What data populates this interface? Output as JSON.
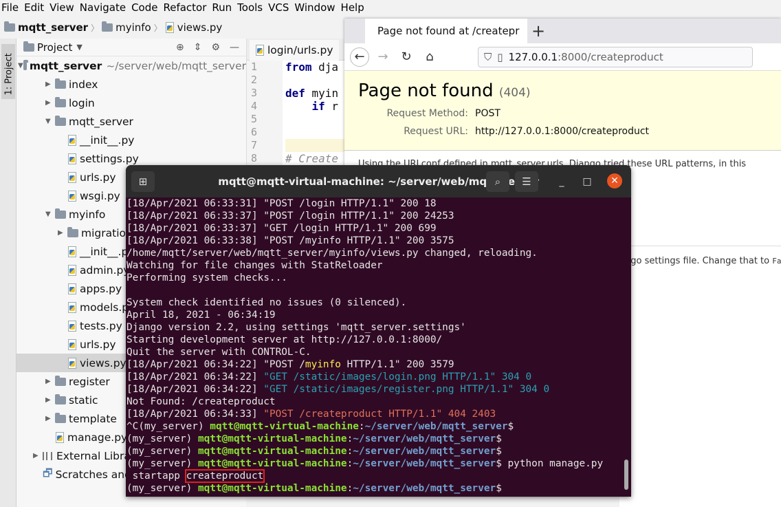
{
  "menubar": [
    "File",
    "Edit",
    "View",
    "Navigate",
    "Code",
    "Refactor",
    "Run",
    "Tools",
    "VCS",
    "Window",
    "Help"
  ],
  "breadcrumb": [
    "mqtt_server",
    "myinfo",
    "views.py"
  ],
  "left_tab": "1: Project",
  "project": {
    "header": "Project",
    "root": "mqtt_server",
    "root_path": "~/server/web/mqtt_server",
    "items": [
      "index",
      "login",
      "mqtt_server",
      "__init__.py",
      "settings.py",
      "urls.py",
      "wsgi.py",
      "myinfo",
      "migrations",
      "__init__.py",
      "admin.py",
      "apps.py",
      "models.py",
      "tests.py",
      "urls.py",
      "views.py",
      "register",
      "static",
      "template",
      "manage.py",
      "External Libraries",
      "Scratches and Co"
    ]
  },
  "editor": {
    "tab": "login/urls.py",
    "line_numbers": [
      "1",
      "2",
      "3",
      "4",
      "5",
      "6",
      "7",
      "8"
    ],
    "lines": [
      {
        "kw": "from",
        "rest": " dja"
      },
      {
        "kw": "",
        "rest": ""
      },
      {
        "kw": "def",
        "rest": " myin"
      },
      {
        "kw": "    if",
        "rest": " r"
      },
      {
        "kw": "",
        "rest": ""
      },
      {
        "kw": "",
        "rest": ""
      },
      {
        "kw": "",
        "rest": ""
      },
      {
        "kw": "",
        "rest": "# Create"
      }
    ]
  },
  "browser": {
    "tab_title": "Page not found at /createpr",
    "url_host": "127.0.0.1",
    "url_rest": ":8000/createproduct",
    "heading": "Page not found",
    "status": "(404)",
    "req_method_label": "Request Method:",
    "req_method": "POST",
    "req_url_label": "Request URL:",
    "req_url": "http://127.0.0.1:8000/createproduct",
    "body_line": "Using the URLconf defined in mqtt_server.urls, Django tried these URL patterns, in this order:",
    "tail_line": "ngo settings file. Change that to",
    "tail_code": "False"
  },
  "terminal": {
    "title": "mqtt@mqtt-virtual-machine: ~/server/web/mqtt_server",
    "lines": [
      [
        {
          "t": "[18/Apr/2021 06:33:31] \"POST /login HTTP/1.1\" 200 18",
          "c": ""
        }
      ],
      [
        {
          "t": "[18/Apr/2021 06:33:37] \"POST /login HTTP/1.1\" 200 24253",
          "c": ""
        }
      ],
      [
        {
          "t": "[18/Apr/2021 06:33:37] \"GET /login HTTP/1.1\" 200 699",
          "c": ""
        }
      ],
      [
        {
          "t": "[18/Apr/2021 06:33:38] \"POST /myinfo HTTP/1.1\" 200 3575",
          "c": ""
        }
      ],
      [
        {
          "t": "/home/mqtt/server/web/mqtt_server/myinfo/views.py changed, reloading.",
          "c": ""
        }
      ],
      [
        {
          "t": "Watching for file changes with StatReloader",
          "c": ""
        }
      ],
      [
        {
          "t": "Performing system checks...",
          "c": ""
        }
      ],
      [
        {
          "t": "",
          "c": ""
        }
      ],
      [
        {
          "t": "System check identified no issues (0 silenced).",
          "c": ""
        }
      ],
      [
        {
          "t": "April 18, 2021 - 06:34:19",
          "c": ""
        }
      ],
      [
        {
          "t": "Django version 2.2, using settings 'mqtt_server.settings'",
          "c": ""
        }
      ],
      [
        {
          "t": "Starting development server at http://127.0.0.1:8000/",
          "c": ""
        }
      ],
      [
        {
          "t": "Quit the server with CONTROL-C.",
          "c": ""
        }
      ],
      [
        {
          "t": "[18/Apr/2021 06:34:22] \"POST /",
          "c": ""
        },
        {
          "t": "myinfo",
          "c": "yel"
        },
        {
          "t": " HTTP/1.1\" 200 3579",
          "c": ""
        }
      ],
      [
        {
          "t": "[18/Apr/2021 06:34:22] ",
          "c": ""
        },
        {
          "t": "\"GET /static/images/login.png HTTP/1.1\" 304 0",
          "c": "cyan"
        }
      ],
      [
        {
          "t": "[18/Apr/2021 06:34:22] ",
          "c": ""
        },
        {
          "t": "\"GET /static/images/register.png HTTP/1.1\" 304 0",
          "c": "cyan"
        }
      ],
      [
        {
          "t": "Not Found: /createproduct",
          "c": ""
        }
      ],
      [
        {
          "t": "[18/Apr/2021 06:34:33] ",
          "c": ""
        },
        {
          "t": "\"POST /createproduct HTTP/1.1\" 404 2403",
          "c": "red"
        }
      ],
      [
        {
          "t": "^C(my_server) ",
          "c": ""
        },
        {
          "t": "mqtt@mqtt-virtual-machine",
          "c": "grn"
        },
        {
          "t": ":",
          "c": ""
        },
        {
          "t": "~/server/web/mqtt_server",
          "c": "blu"
        },
        {
          "t": "$",
          "c": ""
        }
      ],
      [
        {
          "t": "(my_server) ",
          "c": ""
        },
        {
          "t": "mqtt@mqtt-virtual-machine",
          "c": "grn"
        },
        {
          "t": ":",
          "c": ""
        },
        {
          "t": "~/server/web/mqtt_server",
          "c": "blu"
        },
        {
          "t": "$",
          "c": ""
        }
      ],
      [
        {
          "t": "(my_server) ",
          "c": ""
        },
        {
          "t": "mqtt@mqtt-virtual-machine",
          "c": "grn"
        },
        {
          "t": ":",
          "c": ""
        },
        {
          "t": "~/server/web/mqtt_server",
          "c": "blu"
        },
        {
          "t": "$",
          "c": ""
        }
      ],
      [
        {
          "t": "(my_server) ",
          "c": ""
        },
        {
          "t": "mqtt@mqtt-virtual-machine",
          "c": "grn"
        },
        {
          "t": ":",
          "c": ""
        },
        {
          "t": "~/server/web/mqtt_server",
          "c": "blu"
        },
        {
          "t": "$ python manage.py",
          "c": ""
        }
      ],
      [
        {
          "t": " startapp ",
          "c": ""
        },
        {
          "t": "createproduct",
          "c": "hl"
        }
      ],
      [
        {
          "t": "(my_server) ",
          "c": ""
        },
        {
          "t": "mqtt@mqtt-virtual-machine",
          "c": "grn"
        },
        {
          "t": ":",
          "c": ""
        },
        {
          "t": "~/server/web/mqtt_server",
          "c": "blu"
        },
        {
          "t": "$",
          "c": ""
        }
      ]
    ]
  }
}
